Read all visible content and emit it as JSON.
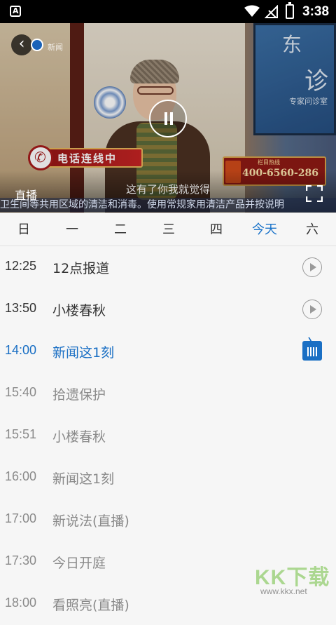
{
  "status_bar": {
    "time": "3:38"
  },
  "player": {
    "channel_text": "新闻",
    "banner_text": "电话连线中",
    "hotline_label": "栏目热线",
    "hotline_number": "400-6560-286",
    "screen_text_1": "东",
    "screen_text_2": "诊",
    "screen_caption": "专家问诊室",
    "live_label": "直播",
    "subtitle": "这有了你我就觉得",
    "ticker": "卫生间等共用区域的清洁和消毒。使用常规家用清洁产品并按说明"
  },
  "tabs": [
    {
      "label": "日",
      "active": false
    },
    {
      "label": "一",
      "active": false
    },
    {
      "label": "二",
      "active": false
    },
    {
      "label": "三",
      "active": false
    },
    {
      "label": "四",
      "active": false
    },
    {
      "label": "今天",
      "active": true
    },
    {
      "label": "六",
      "active": false
    }
  ],
  "schedule": [
    {
      "time": "12:25",
      "title": "12点报道",
      "state": "past",
      "icon": "play-icon"
    },
    {
      "time": "13:50",
      "title": "小楼春秋",
      "state": "past",
      "icon": "play-icon"
    },
    {
      "time": "14:00",
      "title": "新闻这1刻",
      "state": "current",
      "icon": "live-tv-icon"
    },
    {
      "time": "15:40",
      "title": "拾遗保护",
      "state": "future",
      "icon": ""
    },
    {
      "time": "15:51",
      "title": "小楼春秋",
      "state": "future",
      "icon": ""
    },
    {
      "time": "16:00",
      "title": "新闻这1刻",
      "state": "future",
      "icon": ""
    },
    {
      "time": "17:00",
      "title": "新说法(直播)",
      "state": "future",
      "icon": ""
    },
    {
      "time": "17:30",
      "title": "今日开庭",
      "state": "future",
      "icon": ""
    },
    {
      "time": "18:00",
      "title": "看照亮(直播)",
      "state": "future",
      "icon": ""
    }
  ],
  "watermark": {
    "text": "KK下载",
    "url": "www.kkx.net"
  },
  "colors": {
    "accent": "#1a6fc4",
    "past_text": "#333333",
    "future_text": "#8a8a8a"
  }
}
